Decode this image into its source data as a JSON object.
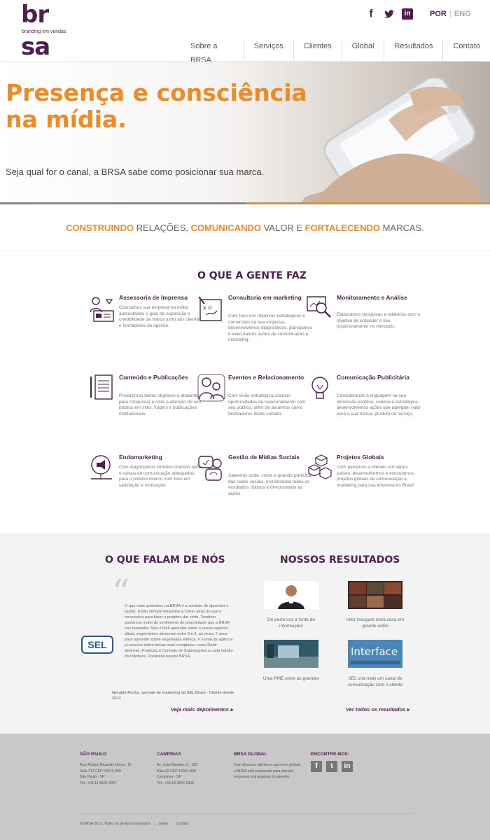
{
  "logo": {
    "top": "br",
    "bottom": "sa",
    "tagline": "branding em vendas"
  },
  "header": {
    "social": [
      "facebook-icon",
      "twitter-icon",
      "linkedin-icon"
    ],
    "lang": {
      "active": "POR",
      "separator": "|",
      "other": "ENG"
    },
    "nav": [
      "Sobre a BRSA",
      "Serviços",
      "Clientes",
      "Global",
      "Resultados",
      "Contato"
    ]
  },
  "hero": {
    "title": "Presença e consciência\nna mídia.",
    "subtitle": "Seja qual for o canal, a BRSA sabe como posicionar sua marca."
  },
  "tagline": {
    "w1": "CONSTRUINDO",
    "t1": " RELAÇÕES, ",
    "w2": "COMUNICANDO",
    "t2": " VALOR E ",
    "w3": "FORTALECENDO",
    "t3": " MARCAS."
  },
  "services": {
    "title": "O QUE A GENTE FAZ",
    "items": [
      {
        "title": "Assessoria de Imprensa",
        "text": "Colocamos sua empresa na mídia aumentando o grau de exposição e credibilidade da marca junto aos clientes e formadores de opinião.",
        "icon": "press-icon"
      },
      {
        "title": "Consultoria em marketing",
        "text": "Com foco nos objetivos estratégicos e comerciais da sua empresa, desenvolvemos diagnósticos, planejamos e executamos ações de comunicação e marketing.",
        "icon": "strategy-board-icon"
      },
      {
        "title": "Monitoramento e Análise",
        "text": "Elaboramos pesquisas e relatórios com o objetivo de entender o seu posicionamento no mercado.",
        "icon": "magnifier-chart-icon"
      },
      {
        "title": "Conteúdo e Publicações",
        "text": "Produzimos textos objetivos e atraentes para conquistar e reter a atenção do seu público em sites, folders e publicações institucionais.",
        "icon": "document-pen-icon"
      },
      {
        "title": "Eventos e Relacionamento",
        "text": "Com visão estratégica,criamos oportunidades de relacionamento com seu público, além de atuarmos como facilitadores deste contato.",
        "icon": "people-icon"
      },
      {
        "title": "Comunicação Publicitária",
        "text": "Considerando a linguagem na sua dimensão estética, criativa e estratégica, desenvolvemos ações que agregam valor para a sua marca, produto ou serviço.",
        "icon": "lightbulb-icon"
      },
      {
        "title": "Endomarketing",
        "text": "Com diagnósticos corretos criamos ações e canais de comunicação adequados para o público interno com foco em satisfação e motivação.",
        "icon": "megaphone-icon"
      },
      {
        "title": "Gestão de Mídias Sociais",
        "text": "Sabemos onde, como e quando participar das redes sociais, monitorando todos os resultados obtidos e direcionando as ações.",
        "icon": "social-media-icon"
      },
      {
        "title": "Projetos Globais",
        "text": "Com parceiros e clientes em vários países, desenvolvemos e executamos projetos globais de comunicação e marketing para sua empresa no Brasil.",
        "icon": "boxes-icon"
      }
    ]
  },
  "testimonials": {
    "title": "O QUE FALAM DE NÓS",
    "quote": "O que mais gostamos na BRSA é a vontade de aprender e ajudar. Estão sempre dispostos a correr atrás do que é necessário para fazer o projetos dar certo. Também gostamos muito do sentimento de propriedade que a BRSA nos transmite. Não é fácil aprender sobre o nosso negócio, afinal, engenheiros demoram entre 5 e 6, as vezes 7 anos para aprender sobre engenharia elétrica, e o time da agência já escreve sobre temas mais complexos como Rede Ethernet, Proteção e Controle de Subestações a cada edição do Interface. Parabéns equipe BRSA.",
    "client_logo": "SEL",
    "author": "Geraldo Rocha, gerente de marketing da SEL Brasil - Cliente desde 2012",
    "more": "Veja mais depoimentos"
  },
  "results": {
    "title": "NOSSOS RESULTADOS",
    "items": [
      {
        "caption": "De porta-voz a fonte de informação!"
      },
      {
        "caption": "Infor inaugura nova casa em grande estilo"
      },
      {
        "caption": "Uma PME entre as grandes"
      },
      {
        "caption": "SEL cria mais um canal de comunicação com o cliente",
        "thumb_text": "Interface"
      }
    ],
    "more": "Ver todos os resultados"
  },
  "footer": {
    "sp": {
      "title": "SÃO PAULO",
      "l1": "Rua Alcides Ricardini Neves, 12",
      "l2": "Sala 712 CEP 04575-050",
      "l3": "São Paulo - SP",
      "l4": "Tel.: +55 11 5501 4007"
    },
    "camp": {
      "title": "CAMPINAS",
      "l1": "Av. João Mendes Jr., 180",
      "l2": "Sala 02 CEP 13024-030",
      "l3": "Campinas - SP",
      "l4": "Tel.: +55 19 3294 1059"
    },
    "global": {
      "title": "BRSA GLOBAL",
      "text": "Com diversos clientes e parceiros globais, a BRSA está preparada para atender empresas estrangeiras localmente."
    },
    "find": {
      "title": "ENCONTRE-NOS:"
    },
    "copyright": "© BRSA 2013. Todos os direitos reservados",
    "sep": "|",
    "link1": "Sobre",
    "link2": "Contato"
  }
}
